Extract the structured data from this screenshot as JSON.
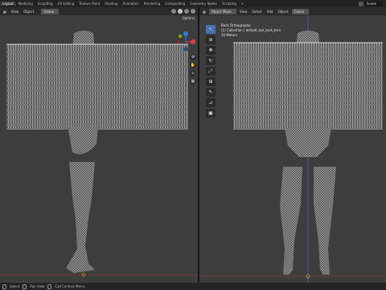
{
  "topbar": {
    "tabs": [
      "Layout",
      "Modeling",
      "Sculpting",
      "UV Editing",
      "Texture Paint",
      "Shading",
      "Animation",
      "Rendering",
      "Compositing",
      "Geometry Nodes",
      "Scripting"
    ],
    "active_tab": "Layout",
    "plus": "+",
    "scene": "Scene"
  },
  "left_viewport": {
    "header": {
      "view": "View",
      "object": "Object",
      "orientation": "Global"
    },
    "options": "Options"
  },
  "right_viewport": {
    "header": {
      "mode": "Object Mode",
      "view": "View",
      "select": "Select",
      "add": "Add",
      "object": "Object",
      "orientation": "Global"
    },
    "overlay": {
      "line1": "Back Orthographic",
      "line2": "(1) Collection | default_tail_sock_trim",
      "line3": "10 Meters"
    }
  },
  "gizmo": {
    "x": "X",
    "y": "Y",
    "z": "Z",
    "colors": {
      "x": "#e23a50",
      "y": "#6b9e1f",
      "z": "#2e7cd6"
    }
  },
  "statusbar": {
    "left": "Select",
    "mid": "Pan View",
    "right": "Call Context Menu"
  },
  "colors": {
    "mesh": "#bdbdbd",
    "active_tool": "#4772b3",
    "axis_z": "#3c6bb5",
    "axis_x": "#a33a3a"
  }
}
